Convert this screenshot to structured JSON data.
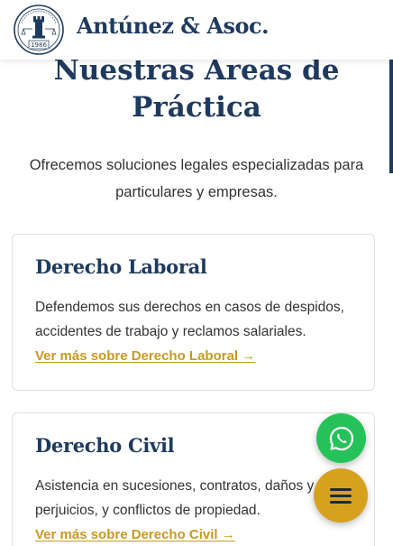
{
  "header": {
    "brand": "Antúnez & Asoc.",
    "logo": {
      "year": "1986",
      "icon": "chess-rook-seal-logo"
    }
  },
  "section": {
    "title_line1": "Nuestras Areas de",
    "title_line2": "Práctica",
    "intro": "Ofrecemos soluciones legales especializadas para particulares y empresas."
  },
  "cards": [
    {
      "title": "Derecho Laboral",
      "description": "Defendemos sus derechos en casos de despidos, accidentes de trabajo y reclamos salariales.",
      "link": "Ver más sobre Derecho Laboral →"
    },
    {
      "title": "Derecho Civil",
      "description": "Asistencia en sucesiones, contratos, daños y perjuicios, y conflictos de propiedad.",
      "link": "Ver más sobre Derecho Civil →"
    }
  ],
  "fabs": {
    "whatsapp_icon": "whatsapp-icon",
    "menu_icon": "hamburger-menu-icon"
  },
  "colors": {
    "primary": "#1e3a5f",
    "accent": "#c79a1e",
    "whatsapp": "#25c25a",
    "menu_button": "#d6a21e"
  }
}
